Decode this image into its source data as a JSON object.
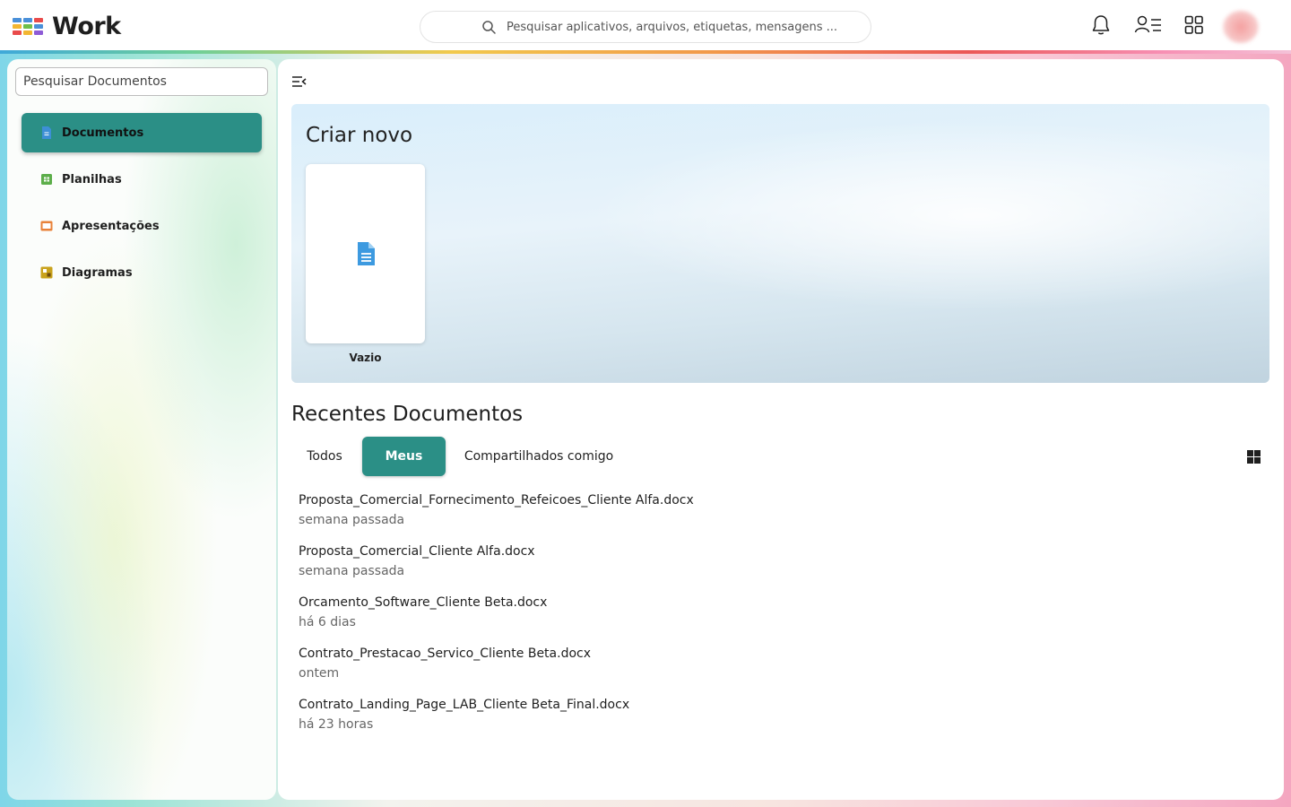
{
  "app": {
    "title": "Work",
    "logo_colors": [
      "#4a90d9",
      "#4a90d9",
      "#e94b4b",
      "#f2b632",
      "#6dbf4b",
      "#4a90d9",
      "#e94b4b",
      "#f2b632",
      "#8e5bd6"
    ]
  },
  "header": {
    "search_placeholder": "Pesquisar aplicativos, arquivos, etiquetas, mensagens ...",
    "icons": [
      "bell-icon",
      "contacts-icon",
      "apps-grid-icon"
    ]
  },
  "sidebar": {
    "search_placeholder": "Pesquisar Documentos",
    "items": [
      {
        "label": "Documentos",
        "icon": "document-icon",
        "color": "#3d8fd6",
        "active": true
      },
      {
        "label": "Planilhas",
        "icon": "spreadsheet-icon",
        "color": "#5cae4a",
        "active": false
      },
      {
        "label": "Apresentações",
        "icon": "presentation-icon",
        "color": "#e8823a",
        "active": false
      },
      {
        "label": "Diagramas",
        "icon": "diagram-icon",
        "color": "#c9a21c",
        "active": false
      }
    ]
  },
  "create": {
    "title": "Criar novo",
    "blank_label": "Vazio"
  },
  "recent": {
    "title": "Recentes Documentos",
    "tabs": [
      {
        "label": "Todos",
        "active": false
      },
      {
        "label": "Meus",
        "active": true
      },
      {
        "label": "Compartilhados comigo",
        "active": false
      }
    ],
    "files": [
      {
        "name": "Proposta_Comercial_Fornecimento_Refeicoes_Cliente Alfa.docx",
        "time": "semana passada"
      },
      {
        "name": "Proposta_Comercial_Cliente Alfa.docx",
        "time": "semana passada"
      },
      {
        "name": "Orcamento_Software_Cliente Beta.docx",
        "time": "há 6 dias"
      },
      {
        "name": "Contrato_Prestacao_Servico_Cliente Beta.docx",
        "time": "ontem"
      },
      {
        "name": "Contrato_Landing_Page_LAB_Cliente Beta_Final.docx",
        "time": "há 23 horas"
      }
    ]
  },
  "colors": {
    "accent": "#2b8f86"
  }
}
